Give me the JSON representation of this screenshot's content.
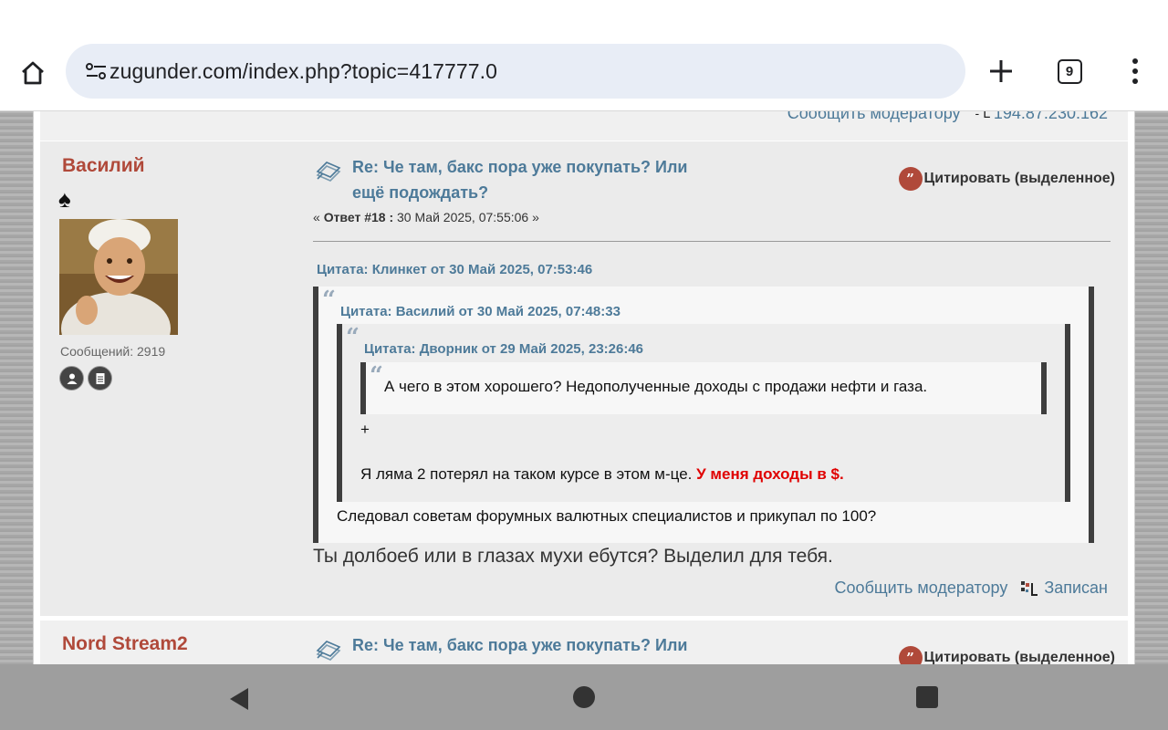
{
  "browser": {
    "url": "zugunder.com/index.php?topic=417777.0",
    "tab_count": "9"
  },
  "prev_post": {
    "report_link": "Сообщить модератору",
    "ip": "194.87.230.162"
  },
  "post1": {
    "poster_name": "Василий",
    "rank_symbol": "♠",
    "messages_label": "Сообщений: 2919",
    "subject_line1": "Re: Че там, бакс пора уже покупать? Или",
    "subject_line2": "ещё подождать?",
    "quote_button": "Цитировать (выделенное)",
    "meta_prefix": "« ",
    "meta_reply": "Ответ #18 :",
    "meta_date": " 30 Май 2025, 07:55:06 »",
    "quote1_header": "Цитата: Клинкет от 30 Май 2025, 07:53:46",
    "quote2_header": "Цитата: Василий от 30 Май 2025, 07:48:33",
    "quote3_header": "Цитата: Дворник от 29 Май 2025, 23:26:46",
    "quote3_text": "А чего в этом хорошего? Недополученные доходы с продажи нефти и газа.",
    "quote2_plus": "+",
    "quote2_text": "Я ляма 2 потерял на таком курсе в этом м-це. ",
    "quote2_red": "У меня доходы в $.",
    "quote1_text": "Следовал советам форумных валютных специалистов и прикупал по 100?",
    "body": "Ты долбоеб или в глазах мухи ебутся? Выделил для тебя.",
    "report_link": "Сообщить модератору",
    "logged": "Записан"
  },
  "post2": {
    "poster_name": "Nord Stream2",
    "subject_line1": "Re: Че там, бакс пора уже покупать? Или",
    "quote_button": "Цитировать (выделенное)"
  },
  "colors": {
    "poster_name": "#b0493a",
    "link": "#4d7a99",
    "highlight": "#e00000"
  }
}
